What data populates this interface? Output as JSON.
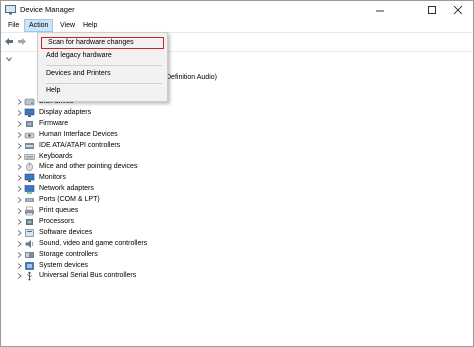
{
  "window": {
    "title": "Device Manager"
  },
  "menubar": {
    "file": "File",
    "action": "Action",
    "view": "View",
    "help": "Help"
  },
  "action_menu": {
    "scan": "Scan for hardware changes",
    "legacy": "Add legacy hardware",
    "printers": "Devices and Printers",
    "help": "Help"
  },
  "tree": {
    "partial_text": "Definition Audio)",
    "categories": [
      {
        "label": "Disk drives",
        "icon": "disk-icon"
      },
      {
        "label": "Display adapters",
        "icon": "monitor-icon"
      },
      {
        "label": "Firmware",
        "icon": "chip-icon"
      },
      {
        "label": "Human Interface Devices",
        "icon": "hid-icon"
      },
      {
        "label": "IDE ATA/ATAPI controllers",
        "icon": "controller-icon"
      },
      {
        "label": "Keyboards",
        "icon": "keyboard-icon"
      },
      {
        "label": "Mice and other pointing devices",
        "icon": "mouse-icon"
      },
      {
        "label": "Monitors",
        "icon": "monitor-icon"
      },
      {
        "label": "Network adapters",
        "icon": "network-icon"
      },
      {
        "label": "Ports (COM & LPT)",
        "icon": "port-icon"
      },
      {
        "label": "Print queues",
        "icon": "printer-icon"
      },
      {
        "label": "Processors",
        "icon": "cpu-icon"
      },
      {
        "label": "Software devices",
        "icon": "software-icon"
      },
      {
        "label": "Sound, video and game controllers",
        "icon": "speaker-icon"
      },
      {
        "label": "Storage controllers",
        "icon": "storage-icon"
      },
      {
        "label": "System devices",
        "icon": "system-icon"
      },
      {
        "label": "Universal Serial Bus controllers",
        "icon": "usb-icon"
      }
    ]
  }
}
